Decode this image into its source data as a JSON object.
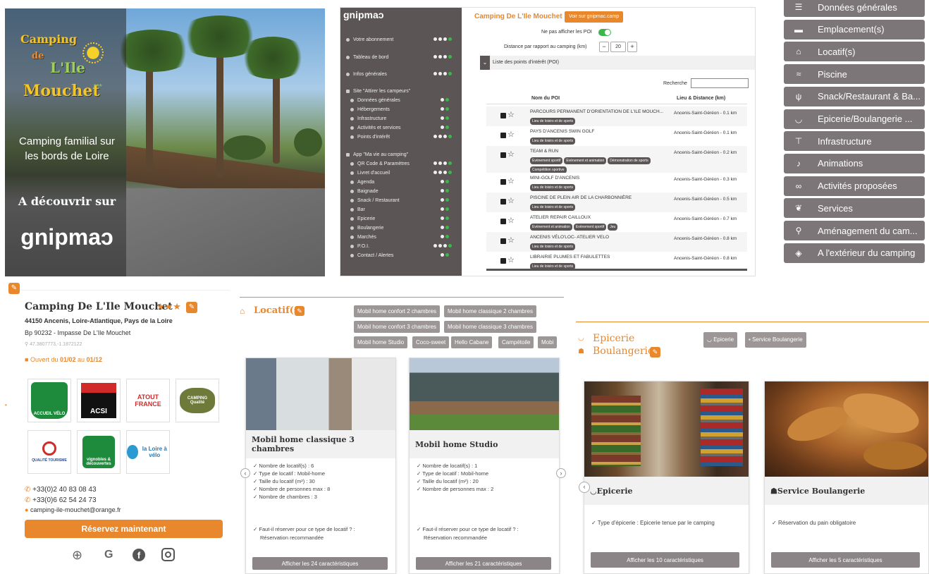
{
  "promo": {
    "logo_line1": "Camping",
    "logo_line2": "de",
    "logo_line3": "L'Ile",
    "logo_line4": "Mouchet",
    "logo_stars": "***",
    "tagline": "Camping familial sur les bords de Loire",
    "discover": "A découvrir sur",
    "brand": "gnipmaɔ"
  },
  "admin": {
    "brand": "gnipmaɔ",
    "title": "Camping De L'Ile Mouchet",
    "view_button": "Voir sur gnipmac.camp",
    "hide_poi_label": "Ne pas afficher les POI",
    "distance_label": "Distance par rapport au camping (km)",
    "distance_value": "20",
    "minus": "−",
    "plus": "+",
    "section_title": "Liste des points d'intérêt (POI)",
    "search_label": "Recherche",
    "col_name": "Nom du POI",
    "col_place": "Lieu & Distance (km)",
    "sidebar": [
      {
        "label": "Votre abonnement",
        "dots": 3,
        "green": true
      },
      {
        "label": "Tableau de bord",
        "dots": 3,
        "green": true
      },
      {
        "label": "Infos générales",
        "dots": 3,
        "green": true
      },
      {
        "label": "Site \"Attirer les campeurs\"",
        "dots": 0,
        "green": false
      },
      {
        "label": "Données générales",
        "dots": 1,
        "green": true
      },
      {
        "label": "Hébergements",
        "dots": 1,
        "green": true
      },
      {
        "label": "Infrastructure",
        "dots": 1,
        "green": true
      },
      {
        "label": "Activités et services",
        "dots": 1,
        "green": true
      },
      {
        "label": "Points d'intérêt",
        "dots": 3,
        "green": true
      },
      {
        "label": "App \"Ma vie au camping\"",
        "dots": 0,
        "green": false
      },
      {
        "label": "QR Code & Paramètres",
        "dots": 3,
        "green": true
      },
      {
        "label": "Livret d'accueil",
        "dots": 3,
        "green": true
      },
      {
        "label": "Agenda",
        "dots": 1,
        "green": true
      },
      {
        "label": "Baignade",
        "dots": 1,
        "green": true
      },
      {
        "label": "Snack / Restaurant",
        "dots": 1,
        "green": true
      },
      {
        "label": "Bar",
        "dots": 1,
        "green": true
      },
      {
        "label": "Epicerie",
        "dots": 1,
        "green": true
      },
      {
        "label": "Boulangerie",
        "dots": 1,
        "green": true
      },
      {
        "label": "Marchés",
        "dots": 1,
        "green": true
      },
      {
        "label": "P.O.I.",
        "dots": 3,
        "green": true
      },
      {
        "label": "Contact / Alertes",
        "dots": 1,
        "green": true
      }
    ],
    "rows": [
      {
        "name": "PARCOURS PERMANENT D'ORIENTATION DE L'ILE MOUCH...",
        "tags": [
          "Lieu de loisirs et de sports"
        ],
        "place": "Ancenis-Saint-Géréon - 0.1 km"
      },
      {
        "name": "PAYS D'ANCENIS SWIN GOLF",
        "tags": [
          "Lieu de loisirs et de sports"
        ],
        "place": "Ancenis-Saint-Géréon - 0.1 km"
      },
      {
        "name": "TEAM & RUN",
        "tags": [
          "Evènement sportif",
          "Evènement et animation",
          "Démonstration de sports",
          "Compétition sportive"
        ],
        "place": "Ancenis-Saint-Géréon - 0.2 km"
      },
      {
        "name": "MINI-GOLF D'ANCENIS",
        "tags": [
          "Lieu de loisirs et de sports"
        ],
        "place": "Ancenis-Saint-Géréon - 0.3 km"
      },
      {
        "name": "PISCINE DE PLEIN AIR DE LA CHARBONNIÈRE",
        "tags": [
          "Lieu de loisirs et de sports"
        ],
        "place": "Ancenis-Saint-Géréon - 0.5 km"
      },
      {
        "name": "ATELIER REPAIR CAILLOUX",
        "tags": [
          "Evènement et animation",
          "Evènement sportif",
          "Jeu"
        ],
        "place": "Ancenis-Saint-Géréon - 0.7 km"
      },
      {
        "name": "ANCENIS VÉLO'LOC- ATELIER VELO",
        "tags": [
          "Lieu de loisirs et de sports"
        ],
        "place": "Ancenis-Saint-Géréon - 0.8 km"
      },
      {
        "name": "LIBRAIRIE PLUMES ET FABULETTES",
        "tags": [
          "Lieu de loisirs et de sports"
        ],
        "place": "Ancenis-Saint-Géréon - 0.8 km"
      }
    ]
  },
  "menu": [
    {
      "label": "Données générales",
      "icon": "list-icon",
      "glyph": "☰"
    },
    {
      "label": "Emplacement(s)",
      "icon": "caravan-icon",
      "glyph": "▬"
    },
    {
      "label": "Locatif(s)",
      "icon": "house-icon",
      "glyph": "⌂"
    },
    {
      "label": "Piscine",
      "icon": "pool-icon",
      "glyph": "≈"
    },
    {
      "label": "Snack/Restaurant & Ba...",
      "icon": "cutlery-icon",
      "glyph": "ψ"
    },
    {
      "label": "Epicerie/Boulangerie ...",
      "icon": "basket-icon",
      "glyph": "◡"
    },
    {
      "label": "Infrastructure",
      "icon": "signpost-icon",
      "glyph": "⊤"
    },
    {
      "label": "Animations",
      "icon": "microphone-icon",
      "glyph": "♪"
    },
    {
      "label": "Activités proposées",
      "icon": "bike-icon",
      "glyph": "∞"
    },
    {
      "label": "Services",
      "icon": "hands-icon",
      "glyph": "❦"
    },
    {
      "label": "Aménagement du cam...",
      "icon": "playground-icon",
      "glyph": "⚲"
    },
    {
      "label": "A l'extérieur du camping",
      "icon": "map-icon",
      "glyph": "◈"
    }
  ],
  "contact": {
    "name": "Camping De L'Ile Mouchet",
    "stars": "★★★",
    "address1": "44150 Ancenis, Loire-Atlantique, Pays de la Loire",
    "address2": "Bp 90232 - Impasse De L'Ile Mouchet",
    "coords": "47.3807773,-1.1872122",
    "open_prefix": "Ouvert du ",
    "open_from": "01/02",
    "open_mid": " au ",
    "open_to": "01/12",
    "certs": [
      "ACCUEIL VÉLO",
      "ACSI",
      "ATOUT FRANCE",
      "CAMPING Qualité",
      "QUALITÉ TOURISME",
      "vignobles & découvertes",
      "la Loire à vélo"
    ],
    "phone1": "+33(0)2 40 83 08 43",
    "phone2": "+33(0)6 62 54 24 73",
    "email": "camping-ile-mouchet@orange.fr",
    "book": "Réservez maintenant"
  },
  "locatifs": {
    "title": "Locatif(s)",
    "tags": [
      "Mobil home confort 2 chambres",
      "Mobil home classique 2 chambres",
      "Mobil home confort 3 chambres",
      "Mobil home classique 3 chambres",
      "Mobil home Studio",
      "Coco-sweet",
      "Hello Cabane",
      "Campétoile",
      "Mobi"
    ],
    "cards": [
      {
        "title": "Mobil home classique 3 chambres",
        "items": [
          "Nombre de locatif(s) : 6",
          "Type de locatif : Mobil-home",
          "Taille du locatif (m²) : 30",
          "Nombre de personnes max : 8",
          "Nombre de chambres : 3"
        ],
        "reserve_q": "Faut-il réserver pour ce type de locatif ? :",
        "reserve_a": "Réservation recommandée",
        "footer": "Afficher les 24 caractéristiques"
      },
      {
        "title": "Mobil home Studio",
        "items": [
          "Nombre de locatif(s) : 1",
          "Type de locatif : Mobil-home",
          "Taille du locatif (m²) : 20",
          "Nombre de personnes max : 2"
        ],
        "reserve_q": "Faut-il réserver pour ce type de locatif ? :",
        "reserve_a": "Réservation recommandée",
        "footer": "Afficher les 21 caractéristiques"
      }
    ]
  },
  "epicerie": {
    "title1": "Epicerie",
    "title2": "Boulangerie",
    "tags": [
      "Epicerie",
      "Service Boulangerie"
    ],
    "cards": [
      {
        "title": "Epicerie",
        "item": "Type d'épicerie : Epicerie tenue par le camping",
        "footer": "Afficher les 10 caractéristiques"
      },
      {
        "title": "Service Boulangerie",
        "item": "Réservation du pain obligatoire",
        "footer": "Afficher les 5 caractéristiques"
      }
    ]
  },
  "colors": {
    "accent": "#e8872b",
    "sidebar": "#5c5556",
    "menu": "#7d7678",
    "green": "#3cb54a"
  }
}
